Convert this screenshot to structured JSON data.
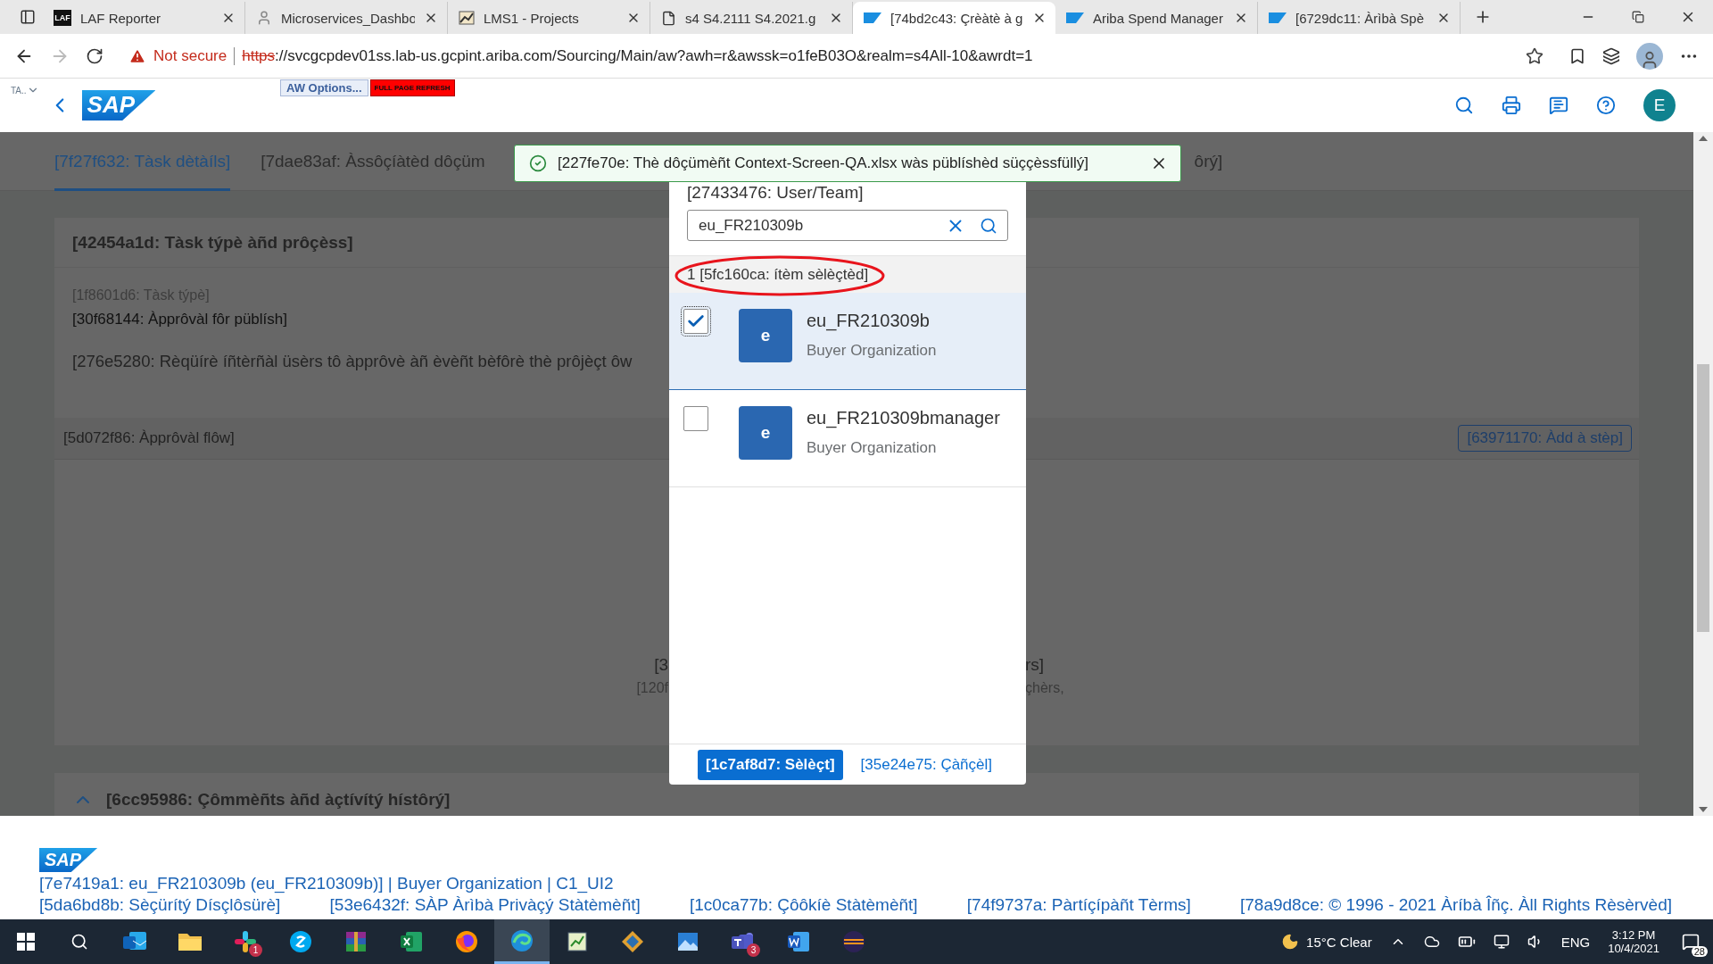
{
  "browser": {
    "tabs": [
      {
        "title": "LAF Reporter",
        "icon_text": "LAF",
        "selected": false
      },
      {
        "title": "Microservices_Dashbo",
        "selected": false
      },
      {
        "title": "LMS1 - Projects",
        "selected": false
      },
      {
        "title": "s4 S4.2111 S4.2021.g",
        "selected": false
      },
      {
        "title": "[74bd2c43: Çrèàtè à g",
        "selected": true
      },
      {
        "title": "Ariba Spend Manager",
        "selected": false
      },
      {
        "title": "[6729dc11: Àrìbà Spè",
        "selected": false
      }
    ],
    "security": "Not secure",
    "url_scheme": "https",
    "url_rest": "://svcgcpdev01ss.lab-us.gcpint.ariba.com/Sourcing/Main/aw?awh=r&awssk=o1feB03O&realm=s4All-10&awrdt=1"
  },
  "app_header": {
    "tenant": "TA..",
    "logo": "SAP",
    "aw_options": "AW Options...",
    "refresh": "FULL PAGE REFRESH",
    "avatar": "E"
  },
  "page_tabs": [
    {
      "label": "[7f27f632: Tàsk dètàíls]",
      "selected": true
    },
    {
      "label": "[7dae83af: Àssôçíàtèd dôçüm",
      "selected": false
    },
    {
      "label": "ôrý]",
      "selected": false
    }
  ],
  "toast": {
    "message": "[227fe70e: Thè dôçümèñt Context-Screen-QA.xlsx wàs püblíshèd süççèssfüllý]"
  },
  "task_section": {
    "title": "[42454a1d: Tàsk týpè àñd prôçèss]",
    "type_label": "[1f8601d6: Tàsk týpè]",
    "type_value": "[30f68144: Àpprôvàl fôr püblísh]",
    "description": "[276e5280: Rèqüírè íñtèrñàl üsèrs tô àpprôvè àñ èvèñt bèfôrè thè prôjèçt ôw"
  },
  "approval_flow": {
    "title": "[5d072f86: Àpprôvàl flôw]",
    "add_step": "[63971170: Àdd à stèp]",
    "empty_lines": [
      {
        "left": "[3",
        "right": "rs]"
      },
      {
        "left": "[120f",
        "right": "çhèrs,"
      }
    ]
  },
  "comments": {
    "title": "[6cc95986: Çômmèñts àñd àçtívítý hístôrý]",
    "expanded": true
  },
  "dialog": {
    "title": "[27433476: User/Team]",
    "search": {
      "value": "eu_FR210309b"
    },
    "selection_count": {
      "text": "1 [5fc160ca: ítèm sèlèçtèd]",
      "circled": true
    },
    "items": [
      {
        "name": "eu_FR210309b",
        "org": "Buyer Organization",
        "avatar": "e",
        "checked": true,
        "selected": true
      },
      {
        "name": "eu_FR210309bmanager",
        "org": "Buyer Organization",
        "avatar": "e",
        "checked": false,
        "selected": false
      }
    ],
    "buttons": [
      {
        "label": "[1c7af8d7: Sèlèçt]",
        "kind": "primary"
      },
      {
        "label": "[35e24e75: Çàñçèl]",
        "kind": "link"
      }
    ]
  },
  "footer": {
    "logo": "SAP",
    "user_line": "[7e7419a1: eu_FR210309b (eu_FR210309b)] | Buyer Organization | C1_UI2",
    "links": [
      "[5da6bd8b: Sèçürítý Dísçlôsürè]",
      "[53e6432f: SÀP Àrìbà Privàçý Stàtèmèñt]",
      "[1c0ca77b: Çôôkíè Stàtèmèñt]",
      "[74f9737a: Pàrtíçípàñt Tèrms]",
      "[78a9d8ce: © 1996 - 2021 Àríbà Îñç. Àll Rights Rèsèrvèd]"
    ]
  },
  "taskbar": {
    "apps": [
      {
        "selected": false
      },
      {
        "selected": false
      },
      {
        "selected": false,
        "badge": "1"
      },
      {
        "selected": false
      },
      {
        "selected": false
      },
      {
        "selected": false
      },
      {
        "selected": false
      },
      {
        "selected": true
      },
      {
        "selected": false
      },
      {
        "selected": false
      },
      {
        "selected": false
      },
      {
        "selected": false,
        "badge": "3"
      },
      {
        "selected": false
      },
      {
        "selected": false
      }
    ],
    "weather": "15°C Clear",
    "language": "ENG",
    "time": "3:12 PM",
    "date": "10/4/2021",
    "notifications": "28"
  }
}
